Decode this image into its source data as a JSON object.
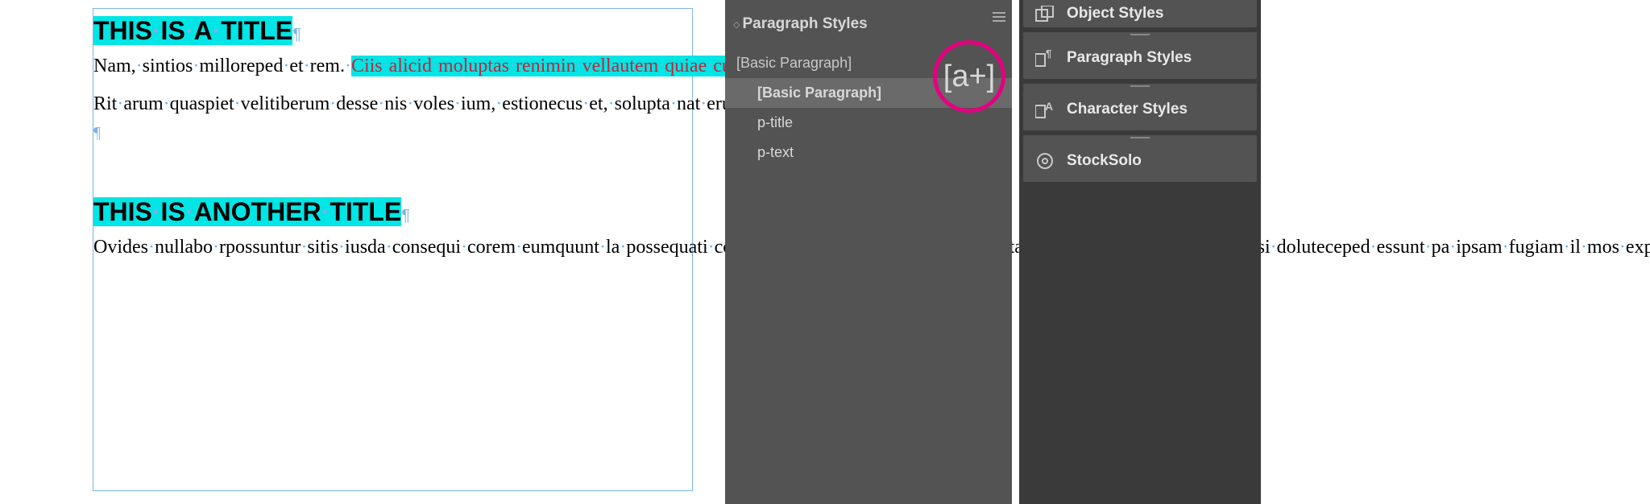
{
  "document": {
    "title1": "THIS IS A TITLE",
    "para1_plain": "Nam, sintios milloreped et rem. ",
    "para1_highlight": "Ciis alicid moluptas renimin vellautem quiae cus aperiae cation corum et dolorat",
    "para2": "Rit arum quaspiet velitiberum desse nis voles ium, estionecus et, solupta nat erum, odi officto blam, sit, totatur?",
    "title2": "THIS IS ANOTHER TITLE",
    "para3": "Ovides nullabo rpossuntur sitis iusda consequi corem eumquunt la possequati consequos quatquis pos autam, volupta quodipic to mos ma soluptassi doluteceped essunt pa ipsam fugiam il mos explicae porepuda porrum"
  },
  "paragraphPanel": {
    "title": "Paragraph Styles",
    "current": "[Basic Paragraph]",
    "styles": [
      {
        "name": "[Basic Paragraph]",
        "selected": true
      },
      {
        "name": "p-title",
        "selected": false
      },
      {
        "name": "p-text",
        "selected": false
      }
    ],
    "newIcon": "[a+]"
  },
  "stack": {
    "objectStyles": "Object Styles",
    "paragraphStyles": "Paragraph Styles",
    "characterStyles": "Character Styles",
    "stockSolo": "StockSolo"
  }
}
